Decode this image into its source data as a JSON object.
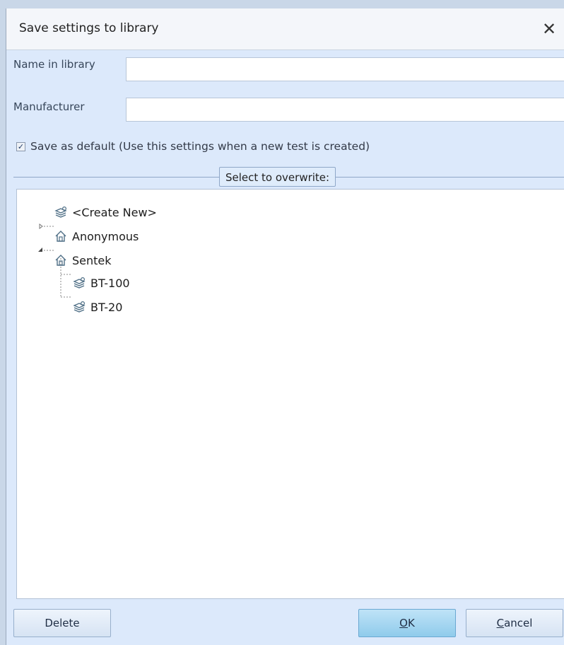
{
  "window": {
    "title": "Save settings to library",
    "close_glyph": "✕"
  },
  "fields": {
    "name_label": "Name in library",
    "name_value": "",
    "manufacturer_label": "Manufacturer",
    "manufacturer_value": ""
  },
  "default_checkbox": {
    "checked": true,
    "label": "Save as default (Use this settings when a new test is created)"
  },
  "group": {
    "caption": "Select to overwrite:"
  },
  "tree": {
    "nodes": [
      {
        "label": "<Create New>",
        "icon": "settings-stack-icon",
        "expander": "none"
      },
      {
        "label": "Anonymous",
        "icon": "home-icon",
        "expander": "collapsed"
      },
      {
        "label": "Sentek",
        "icon": "home-icon",
        "expander": "expanded"
      },
      {
        "label": "BT-100",
        "icon": "settings-stack-icon",
        "expander": "none"
      },
      {
        "label": "BT-20",
        "icon": "settings-stack-icon",
        "expander": "none"
      }
    ]
  },
  "buttons": {
    "delete": "Delete",
    "ok_mnemonic": "O",
    "ok_rest": "K",
    "cancel_mnemonic": "C",
    "cancel_rest": "ancel"
  },
  "colors": {
    "dialog_bg": "#dce9fb",
    "ok_button": "#8fcbeb",
    "accent_border": "#8fa7c8"
  }
}
